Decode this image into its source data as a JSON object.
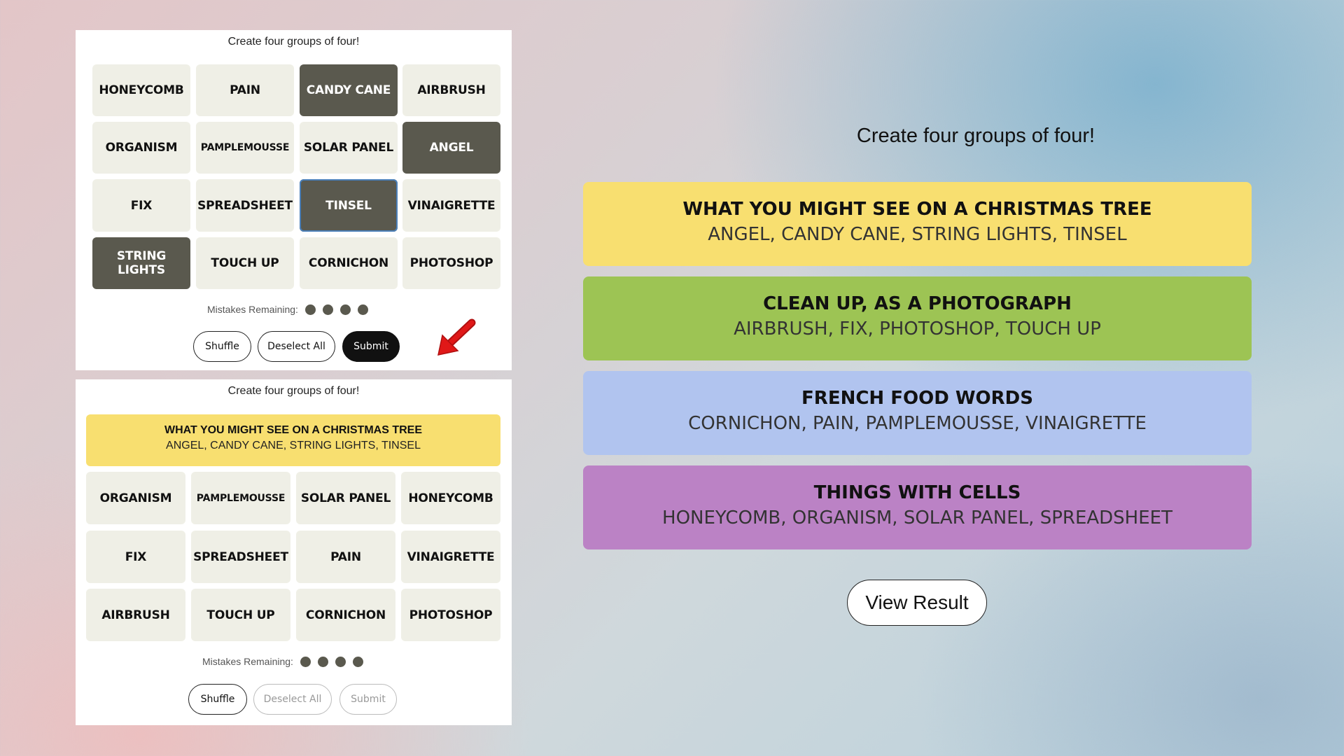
{
  "top_panel": {
    "title": "Create four groups of four!",
    "tiles": [
      {
        "label": "HONEYCOMB",
        "selected": false
      },
      {
        "label": "PAIN",
        "selected": false
      },
      {
        "label": "CANDY CANE",
        "selected": true
      },
      {
        "label": "AIRBRUSH",
        "selected": false
      },
      {
        "label": "ORGANISM",
        "selected": false
      },
      {
        "label": "PAMPLEMOUSSE",
        "selected": false
      },
      {
        "label": "SOLAR PANEL",
        "selected": false
      },
      {
        "label": "ANGEL",
        "selected": true
      },
      {
        "label": "FIX",
        "selected": false
      },
      {
        "label": "SPREADSHEET",
        "selected": false
      },
      {
        "label": "TINSEL",
        "selected": true
      },
      {
        "label": "VINAIGRETTE",
        "selected": false
      },
      {
        "label": "STRING LIGHTS",
        "selected": true
      },
      {
        "label": "TOUCH UP",
        "selected": false
      },
      {
        "label": "CORNICHON",
        "selected": false
      },
      {
        "label": "PHOTOSHOP",
        "selected": false
      }
    ],
    "mistakes_label": "Mistakes Remaining:",
    "mistakes_remaining": 4,
    "shuffle_label": "Shuffle",
    "deselect_label": "Deselect All",
    "submit_label": "Submit"
  },
  "bottom_panel": {
    "title": "Create four groups of four!",
    "solved": {
      "category": "WHAT YOU MIGHT SEE ON A CHRISTMAS TREE",
      "words": "ANGEL, CANDY CANE, STRING LIGHTS, TINSEL",
      "color": "#f8df70"
    },
    "tiles": [
      "ORGANISM",
      "PAMPLEMOUSSE",
      "SOLAR PANEL",
      "HONEYCOMB",
      "FIX",
      "SPREADSHEET",
      "PAIN",
      "VINAIGRETTE",
      "AIRBRUSH",
      "TOUCH UP",
      "CORNICHON",
      "PHOTOSHOP"
    ],
    "mistakes_label": "Mistakes Remaining:",
    "mistakes_remaining": 4,
    "shuffle_label": "Shuffle",
    "deselect_label": "Deselect All",
    "submit_label": "Submit"
  },
  "results": {
    "title": "Create four groups of four!",
    "groups": [
      {
        "category": "WHAT YOU MIGHT SEE ON A CHRISTMAS TREE",
        "words": "ANGEL, CANDY CANE, STRING LIGHTS, TINSEL",
        "color": "#f8df70"
      },
      {
        "category": "CLEAN UP, AS A PHOTOGRAPH",
        "words": "AIRBRUSH, FIX, PHOTOSHOP, TOUCH UP",
        "color": "#9dc454"
      },
      {
        "category": "FRENCH FOOD WORDS",
        "words": "CORNICHON, PAIN, PAMPLEMOUSSE, VINAIGRETTE",
        "color": "#b1c4ef"
      },
      {
        "category": "THINGS WITH CELLS",
        "words": "HONEYCOMB, ORGANISM, SOLAR PANEL, SPREADSHEET",
        "color": "#bb82c5"
      }
    ],
    "view_result_label": "View Result"
  },
  "colors": {
    "tile_bg": "#efefe6",
    "tile_selected": "#5a594e",
    "arrow": "#e01818"
  }
}
